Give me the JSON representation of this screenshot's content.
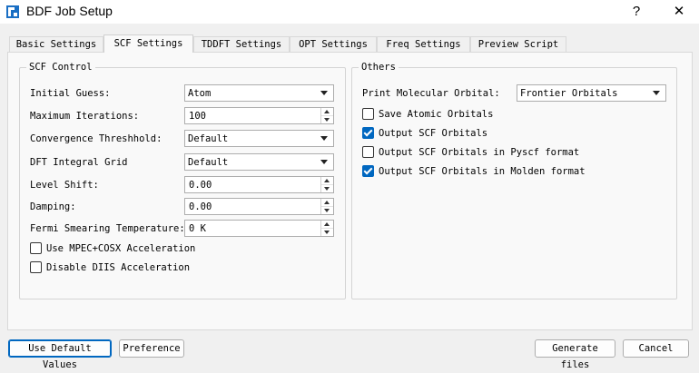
{
  "window": {
    "title": "BDF Job Setup",
    "help_label": "?",
    "close_label": "✕"
  },
  "tabs": [
    {
      "label": "Basic Settings",
      "active": false
    },
    {
      "label": "SCF Settings",
      "active": true
    },
    {
      "label": "TDDFT Settings",
      "active": false
    },
    {
      "label": "OPT Settings",
      "active": false
    },
    {
      "label": "Freq Settings",
      "active": false
    },
    {
      "label": "Preview Script",
      "active": false
    }
  ],
  "scf_control": {
    "title": "SCF Control",
    "initial_guess": {
      "label": "Initial Guess:",
      "value": "Atom"
    },
    "max_iterations": {
      "label": "Maximum Iterations:",
      "value": "100"
    },
    "convergence": {
      "label": "Convergence Threshhold:",
      "value": "Default"
    },
    "dft_grid": {
      "label": "DFT Integral Grid",
      "value": "Default"
    },
    "level_shift": {
      "label": "Level Shift:",
      "value": "0.00"
    },
    "damping": {
      "label": "Damping:",
      "value": "0.00"
    },
    "fermi": {
      "label": "Fermi Smearing Temperature:",
      "value": "0 K"
    },
    "mpec": {
      "label": "Use MPEC+COSX Acceleration",
      "checked": false
    },
    "diis": {
      "label": "Disable DIIS Acceleration",
      "checked": false
    }
  },
  "others": {
    "title": "Others",
    "print_mo": {
      "label": "Print Molecular Orbital:",
      "value": "Frontier Orbitals"
    },
    "save_atomic": {
      "label": "Save Atomic Orbitals",
      "checked": false
    },
    "output_scf": {
      "label": "Output SCF Orbitals",
      "checked": true
    },
    "output_pyscf": {
      "label": "Output SCF Orbitals in Pyscf format",
      "checked": false
    },
    "output_molden": {
      "label": "Output SCF Orbitals in Molden format",
      "checked": true
    }
  },
  "footer": {
    "use_default": "Use Default Values",
    "preference": "Preference",
    "generate": "Generate files",
    "cancel": "Cancel"
  },
  "colors": {
    "accent": "#0067c0",
    "window_bg": "#f0f0f0",
    "panel_bg": "#f9f9f9"
  }
}
